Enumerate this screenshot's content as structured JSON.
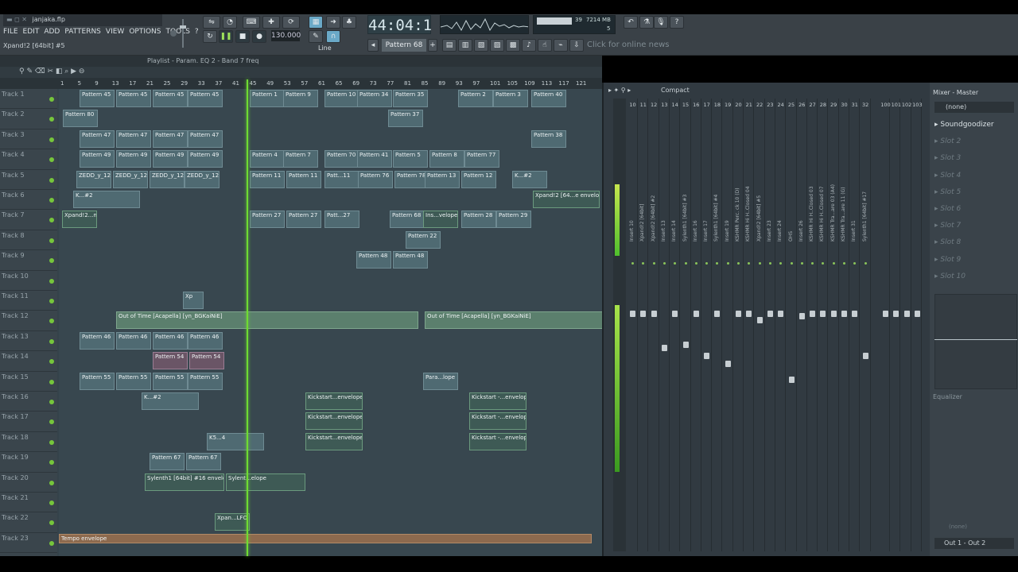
{
  "app": {
    "filename": "janjaka.flp",
    "hint": "Xpand!2 [64bit] #5"
  },
  "menu": [
    "FILE",
    "EDIT",
    "ADD",
    "PATTERNS",
    "VIEW",
    "OPTIONS",
    "TOOLS",
    "?"
  ],
  "transport": {
    "time": "44:04:1",
    "tempo": "130.000",
    "pattern": "Pattern 68",
    "snap": "Line",
    "cpu": "39",
    "mem": "7214 MB",
    "poly": "5"
  },
  "news": "Click for online news",
  "playlist": {
    "title": "Playlist - Param. EQ 2 - Band 7 freq",
    "ruler": [
      "1",
      "5",
      "9",
      "13",
      "17",
      "21",
      "25",
      "29",
      "33",
      "37",
      "41",
      "45",
      "49",
      "53",
      "57",
      "61",
      "65",
      "69",
      "73",
      "77",
      "81",
      "85",
      "89",
      "93",
      "97",
      "101",
      "105",
      "109",
      "113",
      "117",
      "121"
    ],
    "tracks": [
      "Track 1",
      "Track 2",
      "Track 3",
      "Track 4",
      "Track 5",
      "Track 6",
      "Track 7",
      "Track 8",
      "Track 9",
      "Track 10",
      "Track 11",
      "Track 12",
      "Track 13",
      "Track 14",
      "Track 15",
      "Track 16",
      "Track 17",
      "Track 18",
      "Track 19",
      "Track 20",
      "Track 21",
      "Track 22",
      "Track 23"
    ],
    "clips": [
      {
        "row": 0,
        "label": "Pattern 45"
      },
      {
        "row": 0,
        "label": "Pattern 45"
      },
      {
        "row": 0,
        "label": "Pattern 45"
      },
      {
        "row": 0,
        "label": "Pattern 45"
      },
      {
        "row": 0,
        "label": "Pattern 1"
      },
      {
        "row": 0,
        "label": "Pattern 9"
      },
      {
        "row": 0,
        "label": "Pattern 10"
      },
      {
        "row": 0,
        "label": "Pattern 34"
      },
      {
        "row": 0,
        "label": "Pattern 35"
      },
      {
        "row": 0,
        "label": "Pattern 2"
      },
      {
        "row": 0,
        "label": "Pattern 3"
      },
      {
        "row": 0,
        "label": "Pattern 40"
      },
      {
        "row": 1,
        "label": "Pattern 80"
      },
      {
        "row": 1,
        "label": "Pattern 37"
      },
      {
        "row": 2,
        "label": "Pattern 47"
      },
      {
        "row": 2,
        "label": "Pattern 47"
      },
      {
        "row": 2,
        "label": "Pattern 47"
      },
      {
        "row": 2,
        "label": "Pattern 47"
      },
      {
        "row": 2,
        "label": "Pattern 38"
      },
      {
        "row": 3,
        "label": "Pattern 49"
      },
      {
        "row": 3,
        "label": "Pattern 49"
      },
      {
        "row": 3,
        "label": "Pattern 49"
      },
      {
        "row": 3,
        "label": "Pattern 49"
      },
      {
        "row": 3,
        "label": "Pattern 4"
      },
      {
        "row": 3,
        "label": "Pattern 7"
      },
      {
        "row": 3,
        "label": "Pattern 70"
      },
      {
        "row": 3,
        "label": "Pattern 41"
      },
      {
        "row": 3,
        "label": "Pattern 5"
      },
      {
        "row": 3,
        "label": "Pattern 8"
      },
      {
        "row": 3,
        "label": "Pattern 77"
      },
      {
        "row": 4,
        "label": "ZEDD_y_12"
      },
      {
        "row": 4,
        "label": "ZEDD_y_12"
      },
      {
        "row": 4,
        "label": "ZEDD_y_12"
      },
      {
        "row": 4,
        "label": "ZEDD_y_128"
      },
      {
        "row": 4,
        "label": "Pattern 11"
      },
      {
        "row": 4,
        "label": "Pattern 11"
      },
      {
        "row": 4,
        "label": "Patt...11"
      },
      {
        "row": 4,
        "label": "Pattern 76"
      },
      {
        "row": 4,
        "label": "Pattern 78"
      },
      {
        "row": 4,
        "label": "Pattern 13"
      },
      {
        "row": 4,
        "label": "Pattern 12"
      },
      {
        "row": 4,
        "label": "K...#2"
      },
      {
        "row": 5,
        "label": "K...#2"
      },
      {
        "row": 5,
        "label": "Xpand!2 [64...e envelope"
      },
      {
        "row": 6,
        "label": "Xpand!2...nvelope"
      },
      {
        "row": 6,
        "label": "Pattern 27"
      },
      {
        "row": 6,
        "label": "Pattern 27"
      },
      {
        "row": 6,
        "label": "Patt...27"
      },
      {
        "row": 6,
        "label": "Pattern 68"
      },
      {
        "row": 6,
        "label": "Ins...velope"
      },
      {
        "row": 6,
        "label": "Pattern 28"
      },
      {
        "row": 6,
        "label": "Pattern 29"
      },
      {
        "row": 7,
        "label": "Pattern 22"
      },
      {
        "row": 8,
        "label": "Pattern 48"
      },
      {
        "row": 8,
        "label": "Pattern 48"
      },
      {
        "row": 10,
        "label": "Xp"
      },
      {
        "row": 11,
        "label": "Out of Time [Acapella] [yn_BGKaiNiE]"
      },
      {
        "row": 11,
        "label": "Out of Time [Acapella] [yn_BGKaiNiE]"
      },
      {
        "row": 12,
        "label": "Pattern 46"
      },
      {
        "row": 12,
        "label": "Pattern 46"
      },
      {
        "row": 12,
        "label": "Pattern 46"
      },
      {
        "row": 12,
        "label": "Pattern 46"
      },
      {
        "row": 13,
        "label": "Pattern 54"
      },
      {
        "row": 13,
        "label": "Pattern 54"
      },
      {
        "row": 14,
        "label": "Pattern 55"
      },
      {
        "row": 14,
        "label": "Pattern 55"
      },
      {
        "row": 14,
        "label": "Pattern 55"
      },
      {
        "row": 14,
        "label": "Pattern 55"
      },
      {
        "row": 14,
        "label": "Para...lope"
      },
      {
        "row": 15,
        "label": "K...#2"
      },
      {
        "row": 15,
        "label": "Kickstart...envelope"
      },
      {
        "row": 15,
        "label": "Kickstart -...envelope"
      },
      {
        "row": 16,
        "label": "Kickstart...envelope"
      },
      {
        "row": 16,
        "label": "Kickstart -...envelope"
      },
      {
        "row": 17,
        "label": "K5...4"
      },
      {
        "row": 17,
        "label": "Kickstart...envelope"
      },
      {
        "row": 17,
        "label": "Kickstart -...envelope"
      },
      {
        "row": 18,
        "label": "Pattern 67"
      },
      {
        "row": 18,
        "label": "Pattern 67"
      },
      {
        "row": 19,
        "label": "Sylenth1 [64bit] #16 envelope"
      },
      {
        "row": 19,
        "label": "Sylent...elope"
      },
      {
        "row": 21,
        "label": "Xpan...LFO"
      },
      {
        "row": 22,
        "label": "Tempo envelope"
      }
    ]
  },
  "mixer": {
    "view": "Compact",
    "master_label": "Mixer - Master",
    "none_label": "(none)",
    "insert_numbers": [
      "10",
      "11",
      "12",
      "13",
      "14",
      "15",
      "16",
      "17",
      "18",
      "19",
      "20",
      "21",
      "22",
      "23",
      "24",
      "25",
      "26",
      "27",
      "28",
      "29",
      "30",
      "31",
      "32"
    ],
    "insert_names": [
      "Insert 10",
      "Xpand!2 [64bit]",
      "Xpand!2 [64bit] #2",
      "Insert 13",
      "Insert 14",
      "Sylenth1 [64bit] #3",
      "Insert 16",
      "Insert 17",
      "Sylenth1 [64bit] #4",
      "Insert 19",
      "KSHMR Perc. ck 10 (D)",
      "KSHMR Hi H..Closed 04",
      "Xpand!2 [64bit] #5",
      "Insert 23",
      "Insert 24",
      "OHS",
      "Insert 26",
      "KSHMR Hi H..Closed 03",
      "KSHMR Hi H..Closed 07",
      "KSHMR Tra...are 03 (A4)",
      "KSHMR Tra...are 11 (G)",
      "Insert 31",
      "Sylenth1 [64bit] #17"
    ],
    "extra_numbers": [
      "100",
      "101",
      "102",
      "103"
    ],
    "slots": [
      "Soundgoodizer",
      "Slot 2",
      "Slot 3",
      "Slot 4",
      "Slot 5",
      "Slot 6",
      "Slot 7",
      "Slot 8",
      "Slot 9",
      "Slot 10"
    ],
    "eq_label": "Equalizer",
    "out_label": "Out 1 - Out 2",
    "bottom_none": "(none)"
  },
  "colors": {
    "accent": "#6fdc32",
    "clip": "#4f6a72",
    "toolbar": "#3a4147"
  }
}
